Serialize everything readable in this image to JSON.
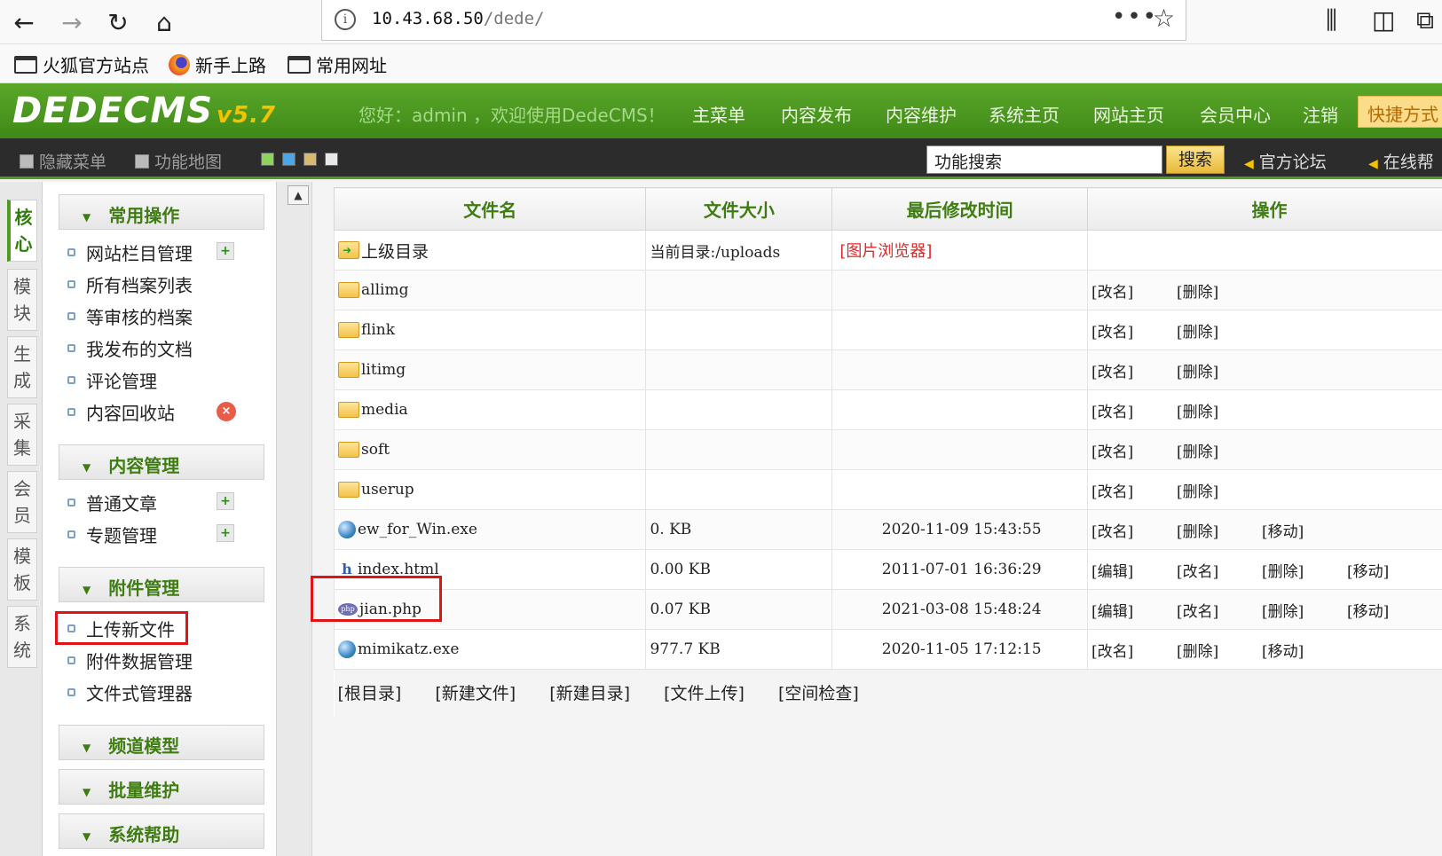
{
  "browser": {
    "url_host": "10.43.68.50",
    "url_path": "/dede/",
    "bookmarks": [
      "火狐官方站点",
      "新手上路",
      "常用网址"
    ]
  },
  "header": {
    "logo": "DEDECMS",
    "version": "v5.7",
    "welcome": "您好：admin ，欢迎使用DedeCMS！",
    "nav": [
      "主菜单",
      "内容发布",
      "内容维护",
      "系统主页",
      "网站主页",
      "会员中心",
      "注销"
    ],
    "quick": "快捷方式"
  },
  "subbar": {
    "hide_menu": "隐藏菜单",
    "func_map": "功能地图",
    "search_value": "功能搜索",
    "search_btn": "搜索",
    "forum": "官方论坛",
    "online_help": "在线帮"
  },
  "vtabs": [
    "核心",
    "模块",
    "生成",
    "采集",
    "会员",
    "模板",
    "系统"
  ],
  "leftmenu": {
    "sections": [
      {
        "title": "常用操作",
        "items": [
          "网站栏目管理",
          "所有档案列表",
          "等审核的档案",
          "我发布的文档",
          "评论管理",
          "内容回收站"
        ]
      },
      {
        "title": "内容管理",
        "items": [
          "普通文章",
          "专题管理"
        ]
      },
      {
        "title": "附件管理",
        "items": [
          "上传新文件",
          "附件数据管理",
          "文件式管理器"
        ]
      },
      {
        "title": "频道模型",
        "items": []
      },
      {
        "title": "批量维护",
        "items": []
      },
      {
        "title": "系统帮助",
        "items": []
      }
    ]
  },
  "filetable": {
    "headers": [
      "文件名",
      "文件大小",
      "最后修改时间",
      "操作"
    ],
    "parent_dir": "上级目录",
    "current_dir": "当前目录:/uploads",
    "image_browser": "[图片浏览器]",
    "rows": [
      {
        "name": "allimg",
        "icon": "folder-icon",
        "size": "",
        "time": "",
        "ops": [
          "[改名]",
          "[删除]"
        ]
      },
      {
        "name": "flink",
        "icon": "folder-icon",
        "size": "",
        "time": "",
        "ops": [
          "[改名]",
          "[删除]"
        ]
      },
      {
        "name": "litimg",
        "icon": "folder-icon",
        "size": "",
        "time": "",
        "ops": [
          "[改名]",
          "[删除]"
        ]
      },
      {
        "name": "media",
        "icon": "folder-icon",
        "size": "",
        "time": "",
        "ops": [
          "[改名]",
          "[删除]"
        ]
      },
      {
        "name": "soft",
        "icon": "folder-icon",
        "size": "",
        "time": "",
        "ops": [
          "[改名]",
          "[删除]"
        ]
      },
      {
        "name": "userup",
        "icon": "folder-icon",
        "size": "",
        "time": "",
        "ops": [
          "[改名]",
          "[删除]"
        ]
      },
      {
        "name": "ew_for_Win.exe",
        "icon": "exe-icon",
        "size": "0. KB",
        "time": "2020-11-09 15:43:55",
        "ops": [
          "[改名]",
          "[删除]",
          "[移动]"
        ]
      },
      {
        "name": "index.html",
        "icon": "html-file-icon",
        "size": "0.00 KB",
        "time": "2011-07-01 16:36:29",
        "ops": [
          "[编辑]",
          "[改名]",
          "[删除]",
          "[移动]"
        ]
      },
      {
        "name": "jian.php",
        "icon": "php-file-icon",
        "size": "0.07 KB",
        "time": "2021-03-08 15:48:24",
        "ops": [
          "[编辑]",
          "[改名]",
          "[删除]",
          "[移动]"
        ]
      },
      {
        "name": "mimikatz.exe",
        "icon": "exe-icon",
        "size": "977.7 KB",
        "time": "2020-11-05 17:12:15",
        "ops": [
          "[改名]",
          "[删除]",
          "[移动]"
        ]
      }
    ],
    "footer_links": [
      "[根目录]",
      "[新建文件]",
      "[新建目录]",
      "[文件上传]",
      "[空间检查]"
    ]
  },
  "colors": {
    "header_green": "#3f8a17",
    "section_title": "#3f7d12",
    "highlight_red": "#e01414",
    "link_red": "#e02828"
  }
}
